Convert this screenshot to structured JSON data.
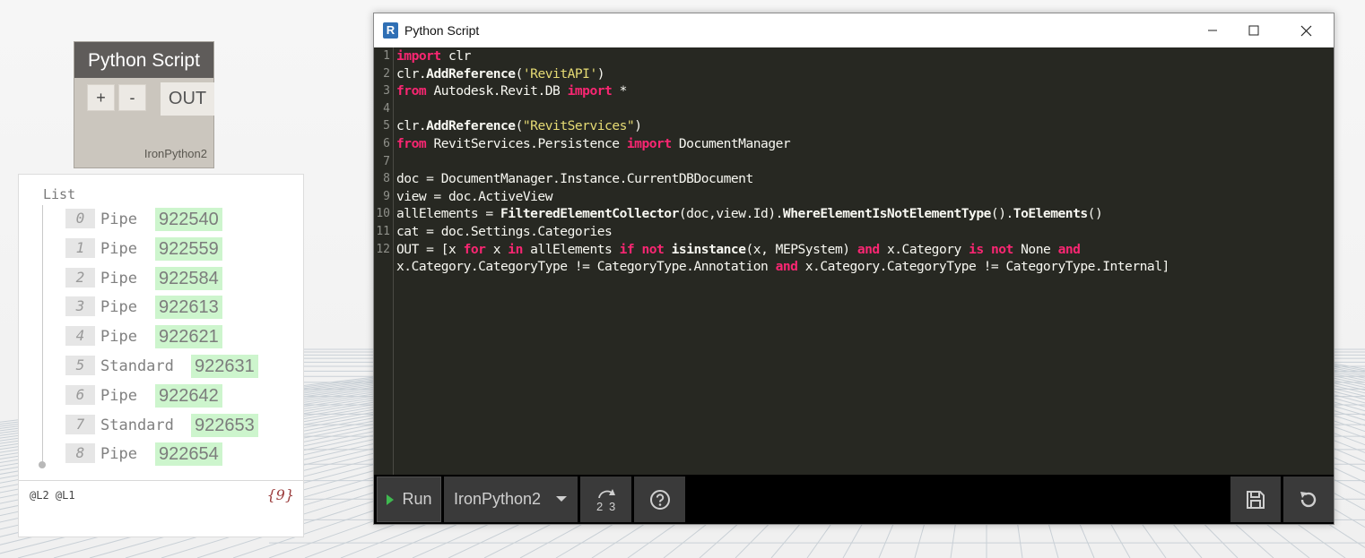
{
  "node": {
    "title": "Python Script",
    "add_label": "+",
    "remove_label": "-",
    "output_label": "OUT",
    "engine": "IronPython2"
  },
  "preview": {
    "title": "List",
    "items": [
      {
        "index": "0",
        "label": "Pipe",
        "value": "922540"
      },
      {
        "index": "1",
        "label": "Pipe",
        "value": "922559"
      },
      {
        "index": "2",
        "label": "Pipe",
        "value": "922584"
      },
      {
        "index": "3",
        "label": "Pipe",
        "value": "922613"
      },
      {
        "index": "4",
        "label": "Pipe",
        "value": "922621"
      },
      {
        "index": "5",
        "label": "Standard",
        "value": "922631"
      },
      {
        "index": "6",
        "label": "Pipe",
        "value": "922642"
      },
      {
        "index": "7",
        "label": "Standard",
        "value": "922653"
      },
      {
        "index": "8",
        "label": "Pipe",
        "value": "922654"
      }
    ],
    "levels": "@L2 @L1",
    "count": "{9}"
  },
  "window": {
    "app_icon_letter": "R",
    "title": "Python Script",
    "icons": {
      "minimize": "minimize-icon",
      "maximize": "maximize-icon",
      "close": "close-icon"
    }
  },
  "editor": {
    "line_numbers": [
      "1",
      "2",
      "3",
      "4",
      "5",
      "6",
      "7",
      "8",
      "9",
      "10",
      "11",
      "12"
    ],
    "lines": [
      [
        {
          "t": "import",
          "c": "kw"
        },
        {
          "t": " clr",
          "c": ""
        }
      ],
      [
        {
          "t": "clr.",
          "c": ""
        },
        {
          "t": "AddReference",
          "c": "fn"
        },
        {
          "t": "(",
          "c": ""
        },
        {
          "t": "'RevitAPI'",
          "c": "str"
        },
        {
          "t": ")",
          "c": ""
        }
      ],
      [
        {
          "t": "from",
          "c": "kw"
        },
        {
          "t": " Autodesk.Revit.DB ",
          "c": ""
        },
        {
          "t": "import",
          "c": "kw"
        },
        {
          "t": " *",
          "c": ""
        }
      ],
      [],
      [
        {
          "t": "clr.",
          "c": ""
        },
        {
          "t": "AddReference",
          "c": "fn"
        },
        {
          "t": "(",
          "c": ""
        },
        {
          "t": "\"RevitServices\"",
          "c": "str"
        },
        {
          "t": ")",
          "c": ""
        }
      ],
      [
        {
          "t": "from",
          "c": "kw"
        },
        {
          "t": " RevitServices.Persistence ",
          "c": ""
        },
        {
          "t": "import",
          "c": "kw"
        },
        {
          "t": " DocumentManager",
          "c": ""
        }
      ],
      [],
      [
        {
          "t": "doc = DocumentManager.Instance.CurrentDBDocument",
          "c": ""
        }
      ],
      [
        {
          "t": "view = doc.ActiveView",
          "c": ""
        }
      ],
      [
        {
          "t": "allElements = ",
          "c": ""
        },
        {
          "t": "FilteredElementCollector",
          "c": "fn"
        },
        {
          "t": "(doc,view.Id).",
          "c": ""
        },
        {
          "t": "WhereElementIsNotElementType",
          "c": "fn"
        },
        {
          "t": "().",
          "c": ""
        },
        {
          "t": "ToElements",
          "c": "fn"
        },
        {
          "t": "()",
          "c": ""
        }
      ],
      [
        {
          "t": "cat = doc.Settings.Categories",
          "c": ""
        }
      ],
      [
        {
          "t": "OUT = [x ",
          "c": ""
        },
        {
          "t": "for",
          "c": "kw"
        },
        {
          "t": " x ",
          "c": ""
        },
        {
          "t": "in",
          "c": "kw"
        },
        {
          "t": " allElements ",
          "c": ""
        },
        {
          "t": "if",
          "c": "kw"
        },
        {
          "t": " ",
          "c": ""
        },
        {
          "t": "not",
          "c": "kw"
        },
        {
          "t": " ",
          "c": ""
        },
        {
          "t": "isinstance",
          "c": "fn"
        },
        {
          "t": "(x, MEPSystem) ",
          "c": ""
        },
        {
          "t": "and",
          "c": "kw"
        },
        {
          "t": " x.Category ",
          "c": ""
        },
        {
          "t": "is",
          "c": "kw"
        },
        {
          "t": " ",
          "c": ""
        },
        {
          "t": "not",
          "c": "kw"
        },
        {
          "t": " None ",
          "c": ""
        },
        {
          "t": "and",
          "c": "kw"
        }
      ],
      [
        {
          "t": "x.Category.CategoryType != CategoryType.Annotation ",
          "c": ""
        },
        {
          "t": "and",
          "c": "kw"
        },
        {
          "t": " x.Category.CategoryType != CategoryType.Internal]",
          "c": ""
        }
      ]
    ]
  },
  "toolbar": {
    "run_label": "Run",
    "engine_value": "IronPython2",
    "migrate_icon": "migrate-icon",
    "help_icon": "help-icon",
    "save_icon": "save-icon",
    "revert_icon": "revert-icon"
  },
  "colors": {
    "editor_bg": "#272822",
    "keyword": "#f92672",
    "string": "#e6db74",
    "preview_value_bg": "#cdf5cd",
    "node_header": "#5f5c5a"
  }
}
